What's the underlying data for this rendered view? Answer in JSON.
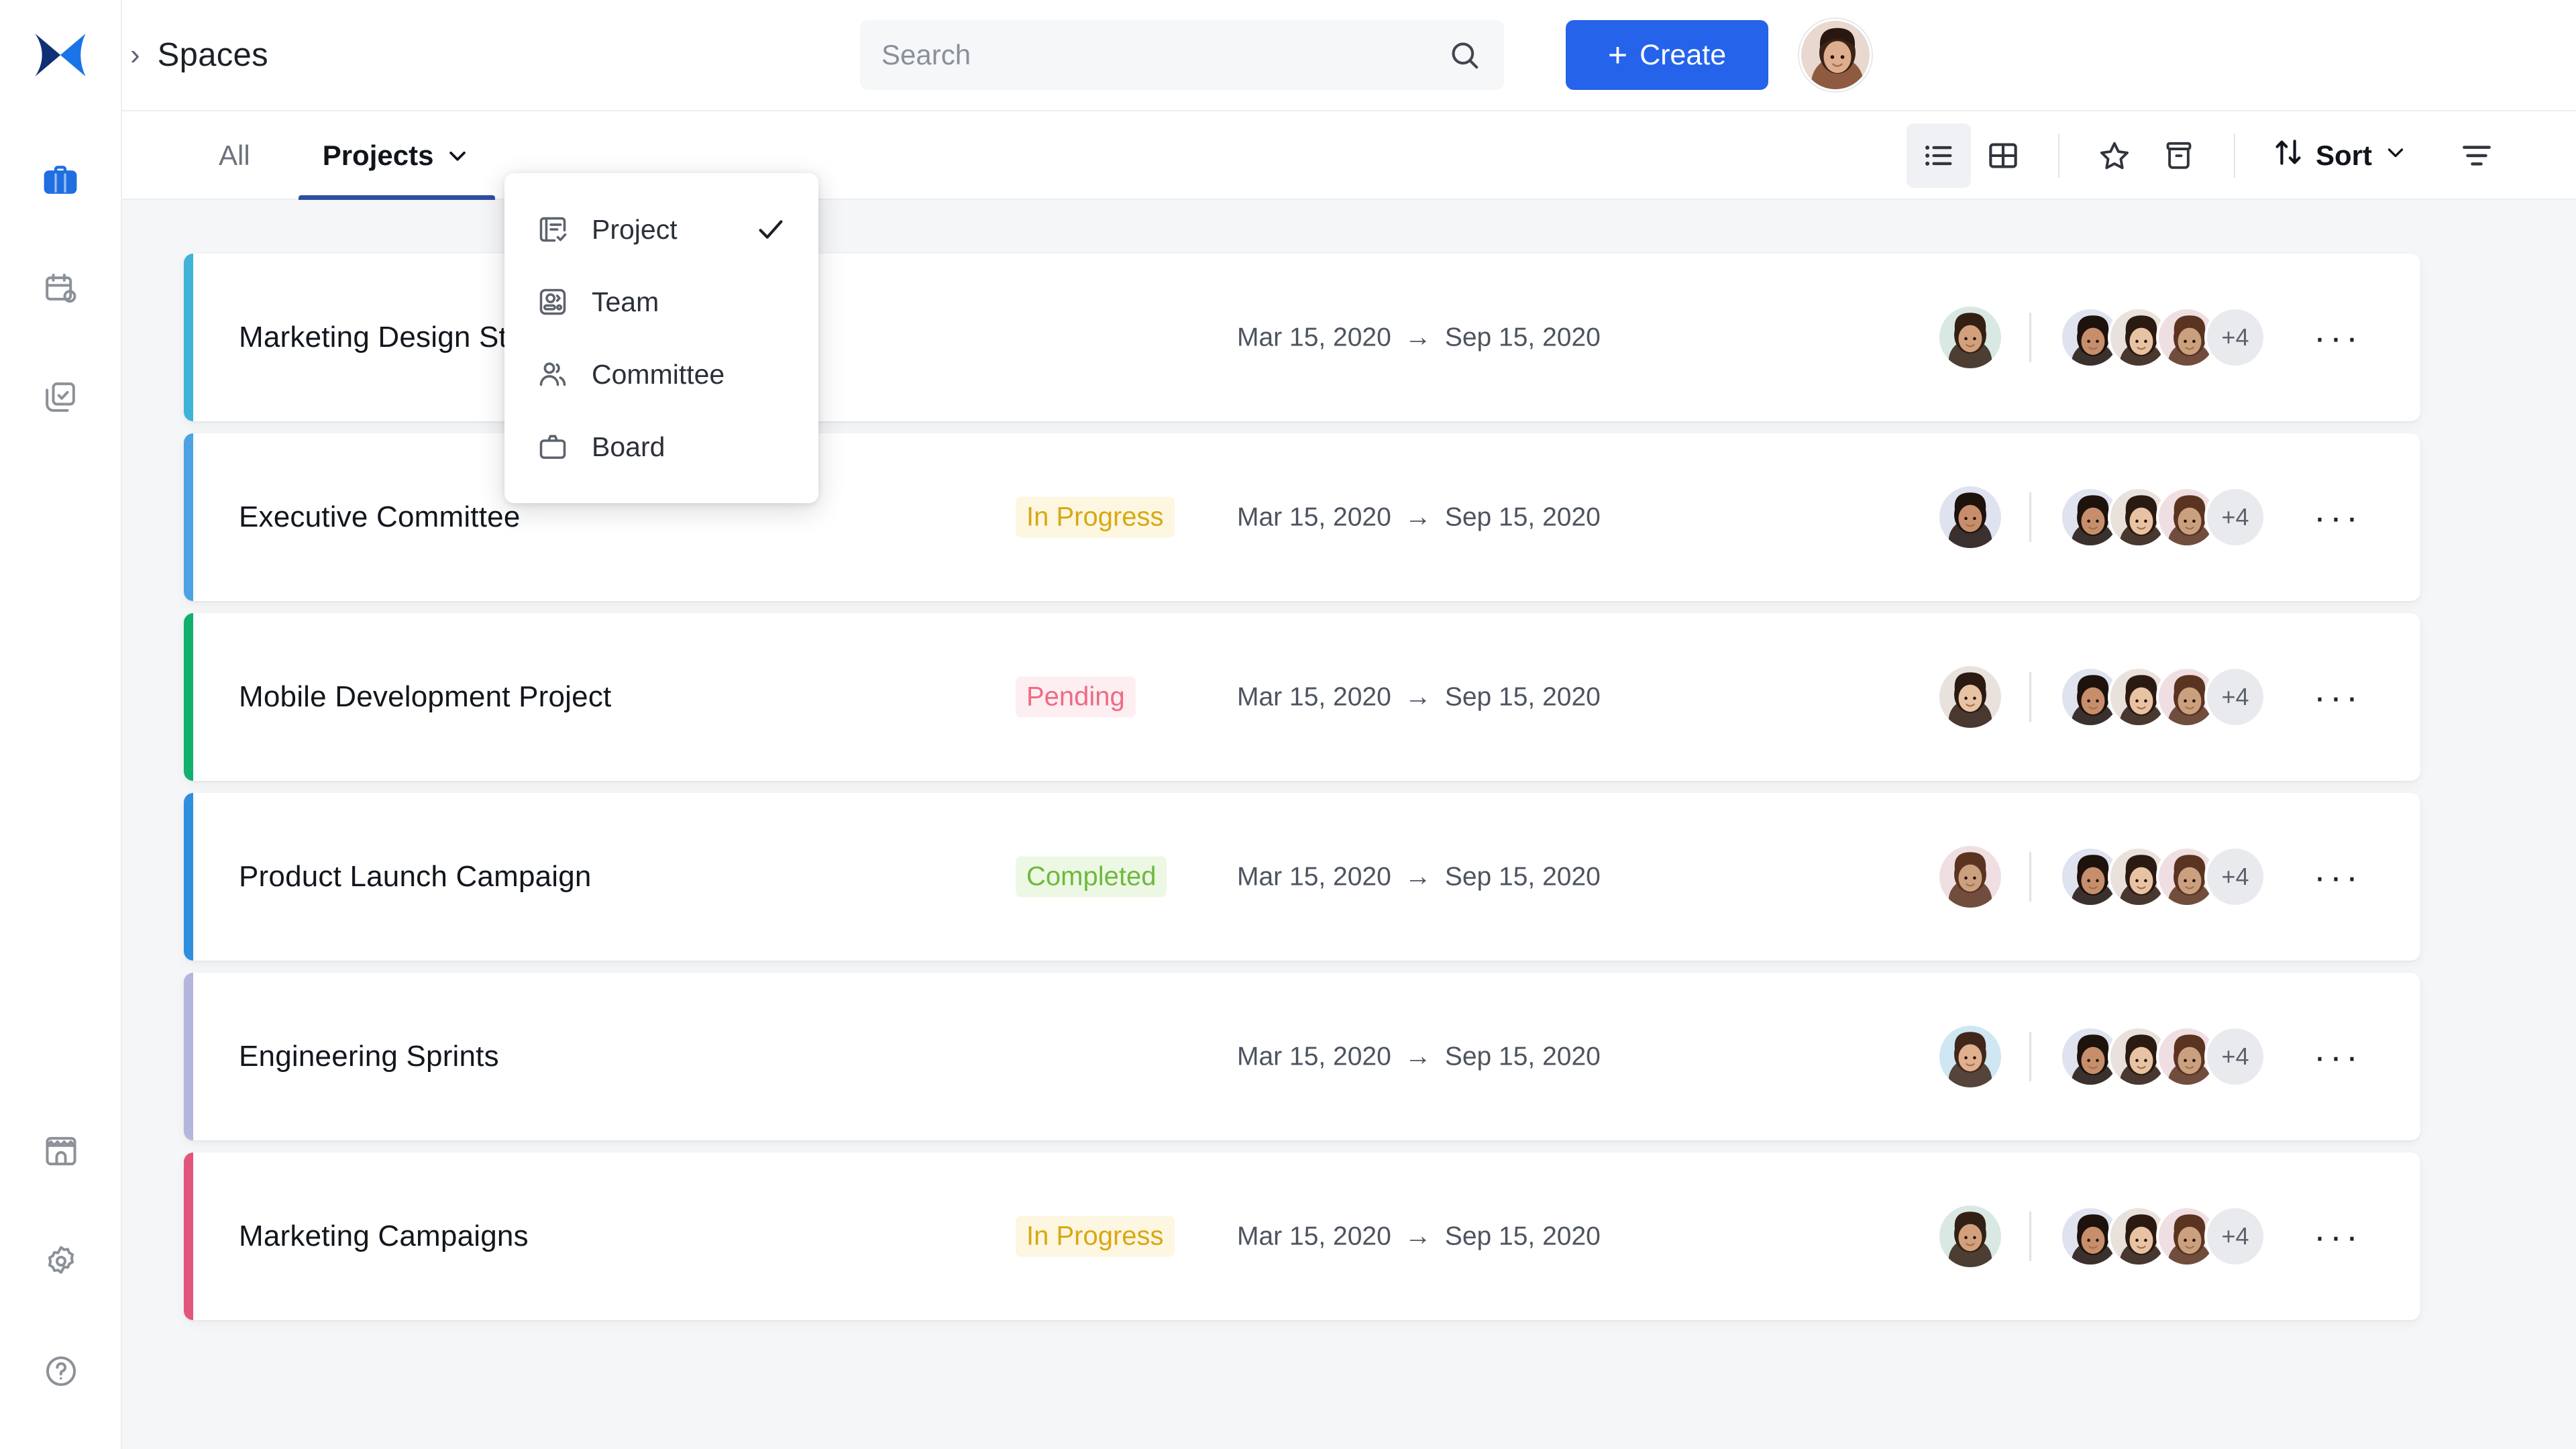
{
  "brand": {
    "logo_name": "butterfly-logo",
    "accent": "#2563eb"
  },
  "breadcrumb": {
    "separator": "›",
    "title": "Spaces"
  },
  "search": {
    "placeholder": "Search",
    "value": "",
    "icon": "search-icon"
  },
  "create_button": {
    "plus": "+",
    "label": "Create"
  },
  "rail": {
    "items": [
      {
        "name": "briefcase-icon",
        "label": "Spaces",
        "active": true
      },
      {
        "name": "calendar-clock-icon",
        "label": "Calendar",
        "active": false
      },
      {
        "name": "tasks-checklist-icon",
        "label": "Tasks",
        "active": false
      }
    ],
    "bottom_items": [
      {
        "name": "marketplace-icon",
        "label": "Marketplace"
      },
      {
        "name": "gear-icon",
        "label": "Settings"
      },
      {
        "name": "help-circle-icon",
        "label": "Help"
      }
    ]
  },
  "tabs": [
    {
      "label": "All",
      "active": false,
      "has_chevron": false
    },
    {
      "label": "Projects",
      "active": true,
      "has_chevron": true
    }
  ],
  "toolbar": {
    "view_list": {
      "name": "list-view-icon",
      "selected": true
    },
    "view_grid": {
      "name": "grid-view-icon",
      "selected": false
    },
    "favorite": {
      "name": "star-icon"
    },
    "archive": {
      "name": "archive-icon"
    },
    "sort": {
      "label": "Sort",
      "icon": "sort-arrows-icon",
      "chevron": "chevron-down-icon"
    },
    "filter": {
      "name": "filter-icon"
    }
  },
  "dropdown": {
    "open": true,
    "items": [
      {
        "label": "Project",
        "icon": "project-board-icon",
        "checked": true
      },
      {
        "label": "Team",
        "icon": "team-card-icon",
        "checked": false
      },
      {
        "label": "Committee",
        "icon": "people-icon",
        "checked": false
      },
      {
        "label": "Board",
        "icon": "board-briefcase-icon",
        "checked": false
      }
    ]
  },
  "list": {
    "date_arrow": "→",
    "more_glyph": "···",
    "overflow_label": "+4",
    "rows": [
      {
        "title": "Marketing Design Str",
        "status": "",
        "status_color": "",
        "status_bg": "",
        "start_date": "Mar 15, 2020",
        "end_date": "Sep 15, 2020",
        "bar_color": "#3fb3d8"
      },
      {
        "title": "Executive Committee",
        "status": "In Progress",
        "status_color": "#d8a815",
        "status_bg": "#fdf6e0",
        "start_date": "Mar 15, 2020",
        "end_date": "Sep 15, 2020",
        "bar_color": "#4ba3e3"
      },
      {
        "title": "Mobile Development Project",
        "status": "Pending",
        "status_color": "#ef6b84",
        "status_bg": "#fdeef1",
        "start_date": "Mar 15, 2020",
        "end_date": "Sep 15, 2020",
        "bar_color": "#12b06d"
      },
      {
        "title": "Product Launch Campaign",
        "status": "Completed",
        "status_color": "#6eb93f",
        "status_bg": "#edf8e4",
        "start_date": "Mar 15, 2020",
        "end_date": "Sep 15, 2020",
        "bar_color": "#2f8fdf"
      },
      {
        "title": "Engineering Sprints",
        "status": "",
        "status_color": "",
        "status_bg": "",
        "start_date": "Mar 15, 2020",
        "end_date": "Sep 15, 2020",
        "bar_color": "#b3b6dd"
      },
      {
        "title": "Marketing Campaigns",
        "status": "In Progress",
        "status_color": "#d8a815",
        "status_bg": "#fdf6e0",
        "start_date": "Mar 15, 2020",
        "end_date": "Sep 15, 2020",
        "bar_color": "#e2567e"
      }
    ]
  }
}
